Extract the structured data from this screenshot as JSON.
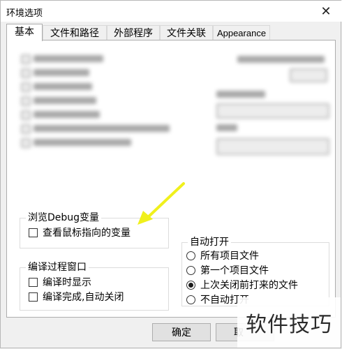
{
  "window": {
    "title": "环境选项",
    "close_icon": "close-icon"
  },
  "tabs": [
    {
      "label": "基本",
      "active": true
    },
    {
      "label": "文件和路径",
      "active": false
    },
    {
      "label": "外部程序",
      "active": false
    },
    {
      "label": "文件关联",
      "active": false
    },
    {
      "label": "Appearance",
      "active": false
    }
  ],
  "debug_group": {
    "legend": "浏览Debug变量",
    "options": [
      {
        "label": "查看鼠标指向的变量",
        "checked": false
      }
    ]
  },
  "compile_group": {
    "legend": "编译过程窗口",
    "options": [
      {
        "label": "编译时显示",
        "checked": false
      },
      {
        "label": "编译完成,自动关闭",
        "checked": false
      }
    ]
  },
  "autoopen_group": {
    "legend": "自动打开",
    "options": [
      {
        "label": "所有项目文件",
        "selected": false
      },
      {
        "label": "第一个项目文件",
        "selected": false
      },
      {
        "label": "上次关闭前打来的文件",
        "selected": true
      },
      {
        "label": "不自动打开",
        "selected": false
      }
    ]
  },
  "footer": {
    "ok_label": "确定",
    "cancel_label": "取"
  },
  "watermark": {
    "text": "软件技巧"
  },
  "colors": {
    "annotation_arrow": "#f0f01c",
    "radio_selected": "#1a1a1a"
  }
}
